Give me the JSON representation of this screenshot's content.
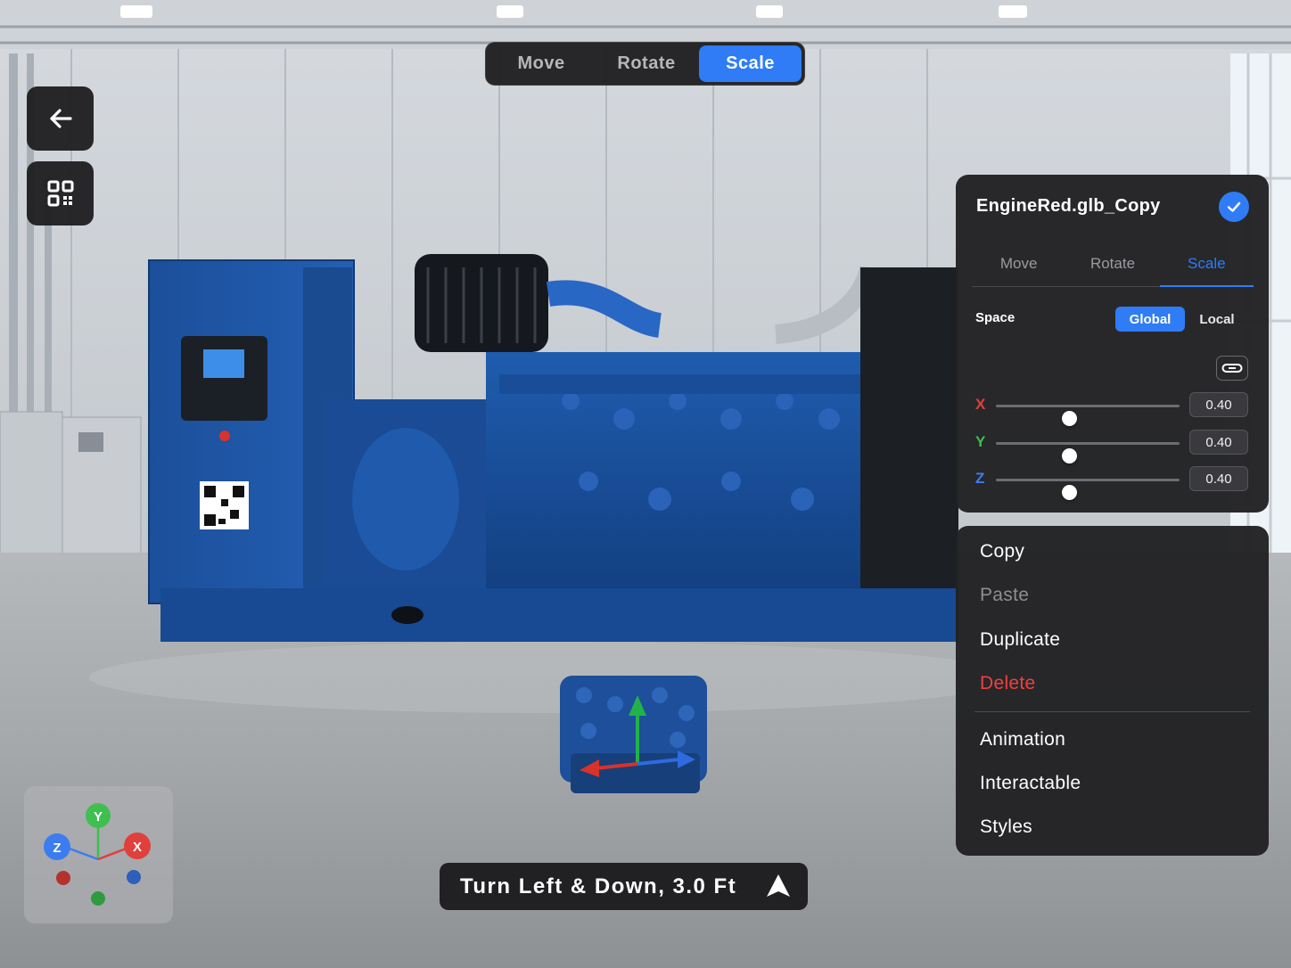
{
  "toolbar": {
    "modes": [
      "Move",
      "Rotate",
      "Scale"
    ],
    "active_mode": "Scale"
  },
  "left_buttons": {
    "back_icon": "arrow-left-icon",
    "qr_icon": "qr-code-icon"
  },
  "properties": {
    "title": "EngineRed.glb_Copy",
    "tabs": [
      "Move",
      "Rotate",
      "Scale"
    ],
    "active_tab": "Scale",
    "space_label": "Space",
    "space_options": [
      "Global",
      "Local"
    ],
    "space_selected": "Global",
    "axes": [
      {
        "label": "X",
        "value": "0.40",
        "level": 0.4,
        "color": "#e0403c"
      },
      {
        "label": "Y",
        "value": "0.40",
        "level": 0.4,
        "color": "#3fbf4f"
      },
      {
        "label": "Z",
        "value": "0.40",
        "level": 0.4,
        "color": "#3d7cf0"
      }
    ]
  },
  "menu": {
    "items": [
      {
        "label": "Copy",
        "state": "normal"
      },
      {
        "label": "Paste",
        "state": "disabled"
      },
      {
        "label": "Duplicate",
        "state": "normal"
      },
      {
        "label": "Delete",
        "state": "danger"
      },
      {
        "label": "Animation",
        "state": "normal"
      },
      {
        "label": "Interactable",
        "state": "normal"
      },
      {
        "label": "Styles",
        "state": "normal"
      }
    ]
  },
  "hint": {
    "text": "Turn Left & Down, 3.0 Ft",
    "icon": "navigation-arrow-icon"
  },
  "gizmo": {
    "labels": {
      "y": "Y",
      "z": "Z",
      "x": "X"
    },
    "colors": {
      "x": "#e0403c",
      "y": "#3fbf4f",
      "z": "#3d7cf0"
    }
  },
  "colors": {
    "accent": "#2f7cf6",
    "panel": "#222224",
    "danger": "#f04040"
  }
}
